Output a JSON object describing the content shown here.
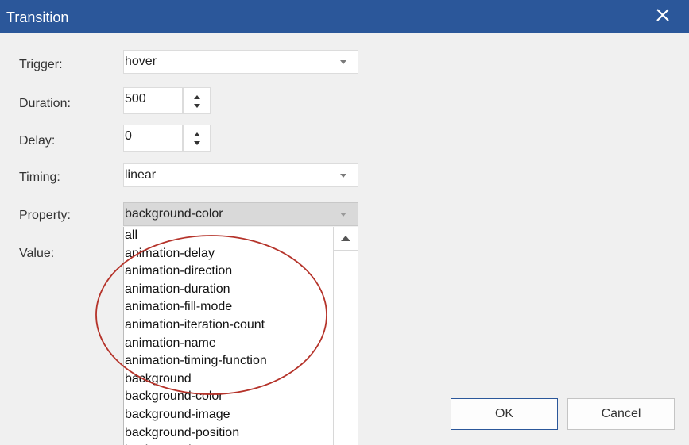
{
  "dialog": {
    "title": "Transition",
    "close_icon": "close-icon",
    "title_bar_color": "#2b579a"
  },
  "form": {
    "trigger": {
      "label": "Trigger:",
      "value": "hover"
    },
    "duration": {
      "label": "Duration:",
      "value": "500"
    },
    "delay": {
      "label": "Delay:",
      "value": "0"
    },
    "timing": {
      "label": "Timing:",
      "value": "linear"
    },
    "property": {
      "label": "Property:",
      "value": "background-color"
    },
    "value": {
      "label": "Value:"
    }
  },
  "property_dropdown": {
    "options": [
      "all",
      "animation-delay",
      "animation-direction",
      "animation-duration",
      "animation-fill-mode",
      "animation-iteration-count",
      "animation-name",
      "animation-timing-function",
      "background",
      "background-color",
      "background-image",
      "background-position",
      "background-repeat"
    ],
    "scroll_up_icon": "scroll-up-arrow-icon"
  },
  "annotation": {
    "shape": "ellipse",
    "color": "#b5332a"
  },
  "buttons": {
    "ok": "OK",
    "cancel": "Cancel"
  }
}
